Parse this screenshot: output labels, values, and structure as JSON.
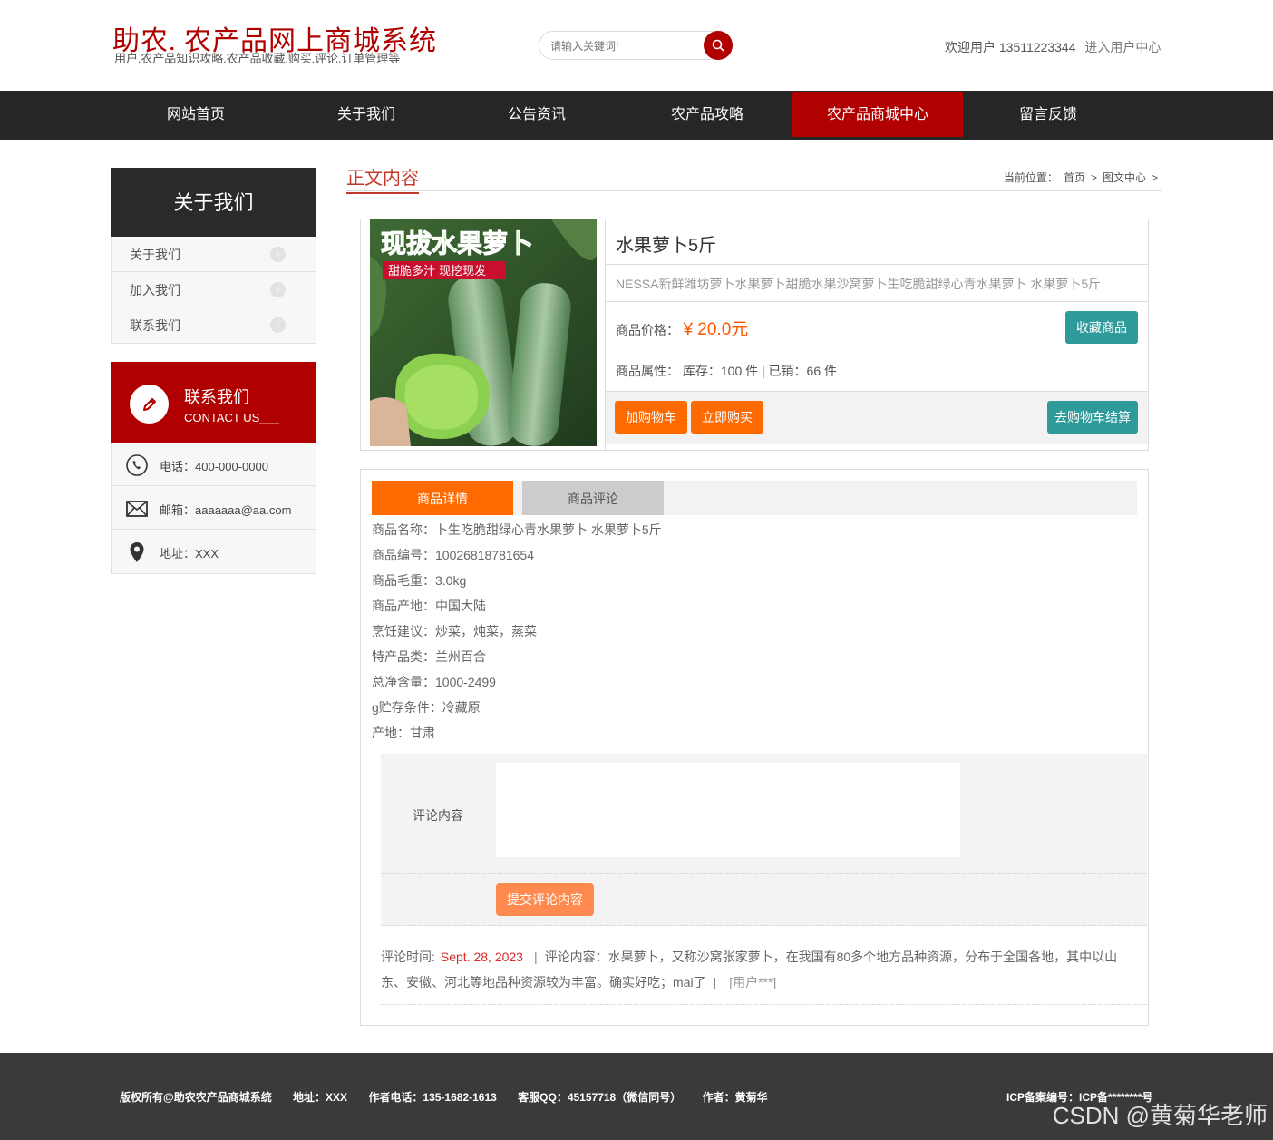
{
  "header": {
    "site_title": "助农. 农产品网上商城系统",
    "site_subtitle": "用户.农产品知识攻略.农产品收藏.购买.评论.订单管理等",
    "search_placeholder": "请输入关键词!",
    "welcome_text": "欢迎用户 13511223344",
    "user_center_link": "进入用户中心"
  },
  "nav": {
    "items": [
      {
        "label": "网站首页"
      },
      {
        "label": "关于我们"
      },
      {
        "label": "公告资讯"
      },
      {
        "label": "农产品攻略"
      },
      {
        "label": "农产品商城中心",
        "active": true
      },
      {
        "label": "留言反馈"
      }
    ]
  },
  "sidebar": {
    "title": "关于我们",
    "items": [
      {
        "label": "关于我们"
      },
      {
        "label": "加入我们"
      },
      {
        "label": "联系我们"
      }
    ],
    "contact": {
      "title": "联系我们",
      "subtitle": "CONTACT US___",
      "items": [
        {
          "icon": "phone-icon",
          "text": "电话：400-000-0000"
        },
        {
          "icon": "mail-icon",
          "text": "邮箱：aaaaaaa@aa.com"
        },
        {
          "icon": "location-pin-icon",
          "text": "地址：XXX"
        }
      ]
    }
  },
  "main": {
    "section_title": "正文内容",
    "breadcrumb": {
      "prefix": "当前位置：",
      "items": [
        "首页",
        "图文中心"
      ],
      "separator": ">"
    }
  },
  "product": {
    "image_banner_text": "现拔水果萝卜",
    "image_tag_text": "甜脆多汁 现挖现发",
    "name": "水果萝卜5斤",
    "description": "NESSA新鲜潍坊萝卜水果萝卜甜脆水果沙窝萝卜生吃脆甜绿心青水果萝卜 水果萝卜5斤",
    "price_label": "商品价格：",
    "price": "¥ 20.0元",
    "attr_label": "商品属性：",
    "attr_value": "库存：100 件 | 已销：66 件",
    "buttons": {
      "favorite": "收藏商品",
      "add_to_cart": "加购物车",
      "buy_now": "立即购买",
      "checkout": "去购物车结算"
    }
  },
  "tabs": [
    {
      "label": "商品详情",
      "active": true
    },
    {
      "label": "商品评论",
      "active": false
    }
  ],
  "details": [
    "商品名称：卜生吃脆甜绿心青水果萝卜 水果萝卜5斤",
    "商品编号：10026818781654",
    "商品毛重：3.0kg",
    "商品产地：中国大陆",
    "烹饪建议：炒菜，炖菜，蒸菜",
    "特产品类：兰州百合",
    "总净含量：1000-2499",
    "g贮存条件：冷藏原",
    "产地：甘肃"
  ],
  "comment_form": {
    "label": "评论内容",
    "submit": "提交评论内容"
  },
  "comments": [
    {
      "time_label": "评论时间:",
      "date": "Sept. 28, 2023",
      "separator": "|",
      "content": "评论内容：水果萝卜，又称沙窝张家萝卜，在我国有80多个地方品种资源，分布于全国各地，其中以山东、安徽、河北等地品种资源较为丰富。确实好吃；mai了",
      "user": "[用户***]"
    }
  ],
  "footer": {
    "copyright": "版权所有@助农农产品商城系统",
    "address": "地址：XXX",
    "phone": "作者电话：135-1682-1613",
    "qq": "客服QQ：45157718（微信同号）",
    "author": "作者：黄菊华",
    "icp": "ICP备案编号：ICP备********号"
  },
  "watermark": "CSDN @黄菊华老师",
  "colors": {
    "brand_red": "#b00000",
    "nav_dark": "#262626",
    "orange": "#ff6a00",
    "teal": "#2f9a9a",
    "price": "#ff5500"
  }
}
